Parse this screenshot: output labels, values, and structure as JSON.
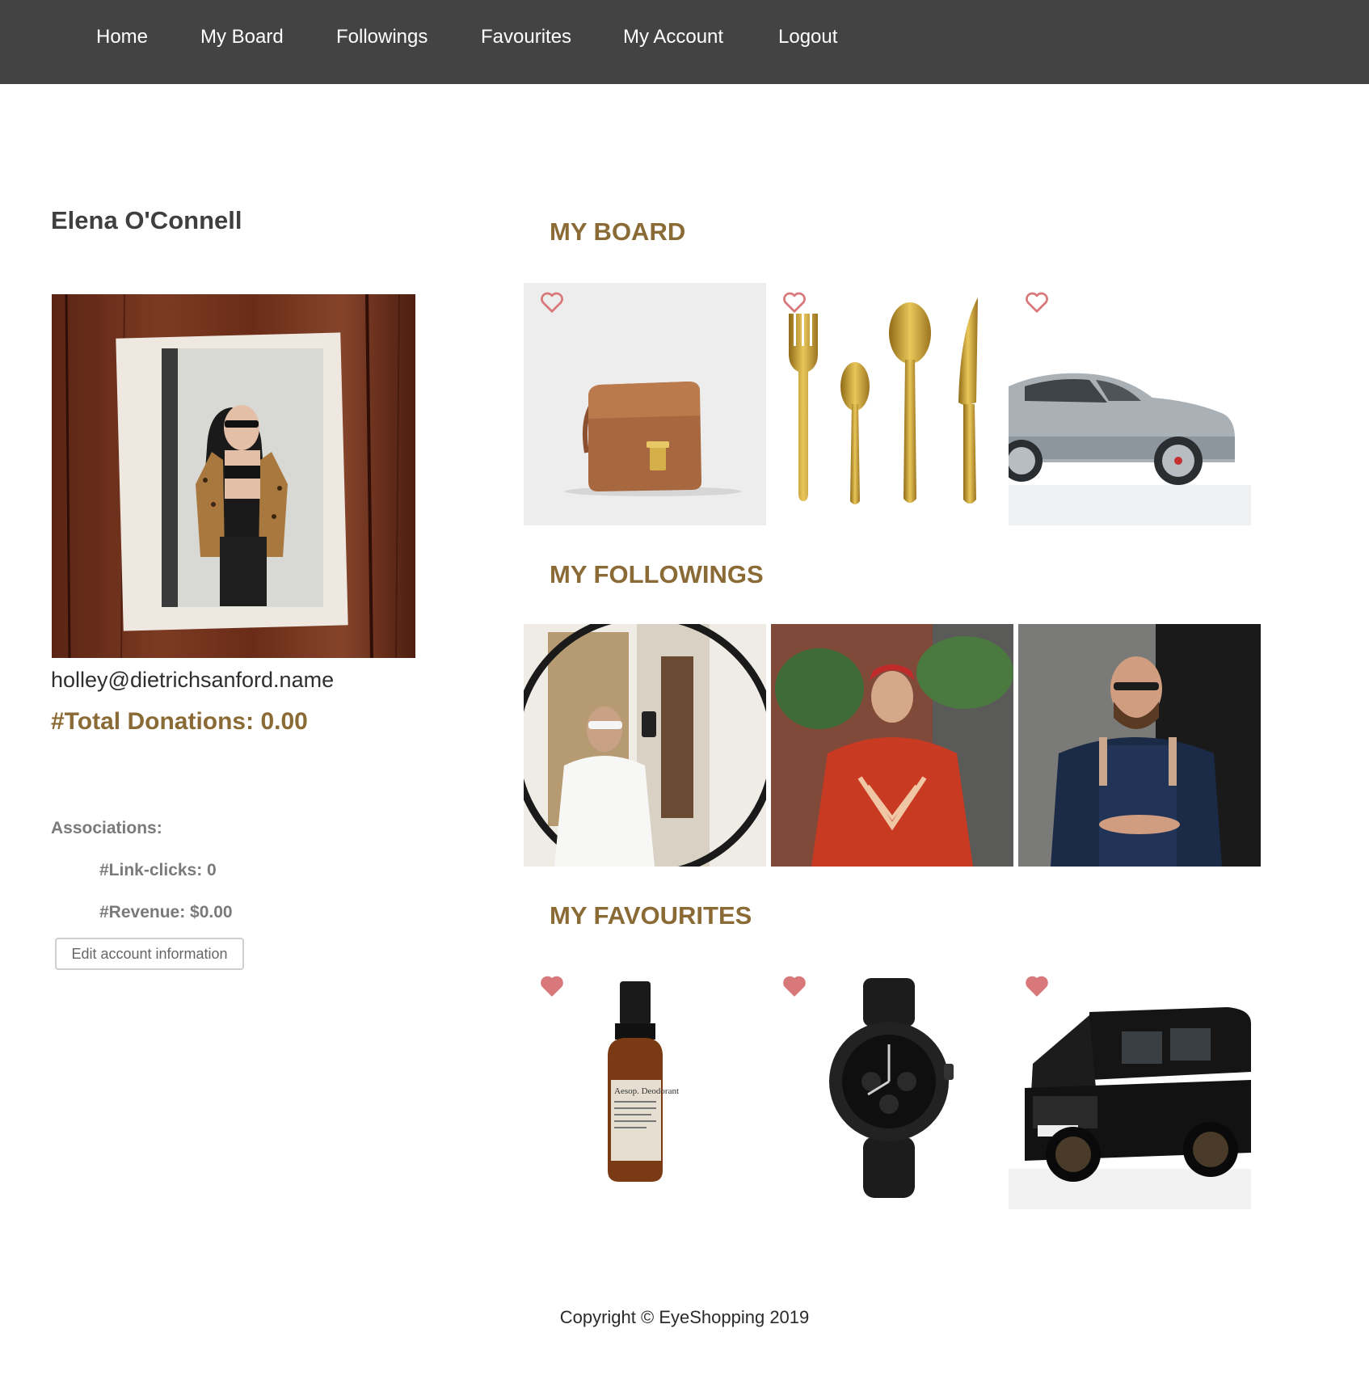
{
  "nav": {
    "items": [
      {
        "label": "Home"
      },
      {
        "label": "My Board"
      },
      {
        "label": "Followings"
      },
      {
        "label": "Favourites"
      },
      {
        "label": "My Account"
      },
      {
        "label": "Logout"
      }
    ]
  },
  "profile": {
    "name": "Elena O'Connell",
    "email": "holley@dietrichsanford.name",
    "total_donations": "#Total Donations: 0.00",
    "associations_label": "Associations:",
    "link_clicks": "#Link-clicks: 0",
    "revenue": "#Revenue: $0.00",
    "edit_label": "Edit account information"
  },
  "board": {
    "title": "MY BOARD",
    "items": [
      {
        "image": "brown-leather-handbag",
        "icon": "heart-outline-icon"
      },
      {
        "image": "gold-cutlery-set",
        "icon": "heart-outline-icon"
      },
      {
        "image": "silver-sports-car",
        "icon": "heart-outline-icon"
      }
    ]
  },
  "followings": {
    "title": "MY FOLLOWINGS",
    "items": [
      {
        "image": "man-white-robe-mirror-selfie"
      },
      {
        "image": "man-red-shirt-street"
      },
      {
        "image": "man-blue-apron"
      }
    ]
  },
  "favourites": {
    "title": "MY FAVOURITES",
    "items": [
      {
        "image": "deodorant-bottle",
        "icon": "heart-filled-icon",
        "label_text": "Aesop. Deodorant"
      },
      {
        "image": "black-wristwatch",
        "icon": "heart-filled-icon"
      },
      {
        "image": "black-suv",
        "icon": "heart-filled-icon"
      }
    ]
  },
  "footer": {
    "text": "Copyright © EyeShopping 2019"
  },
  "colors": {
    "nav_bg": "#444343",
    "accent": "#8a6a35",
    "heart": "#d9787a"
  }
}
